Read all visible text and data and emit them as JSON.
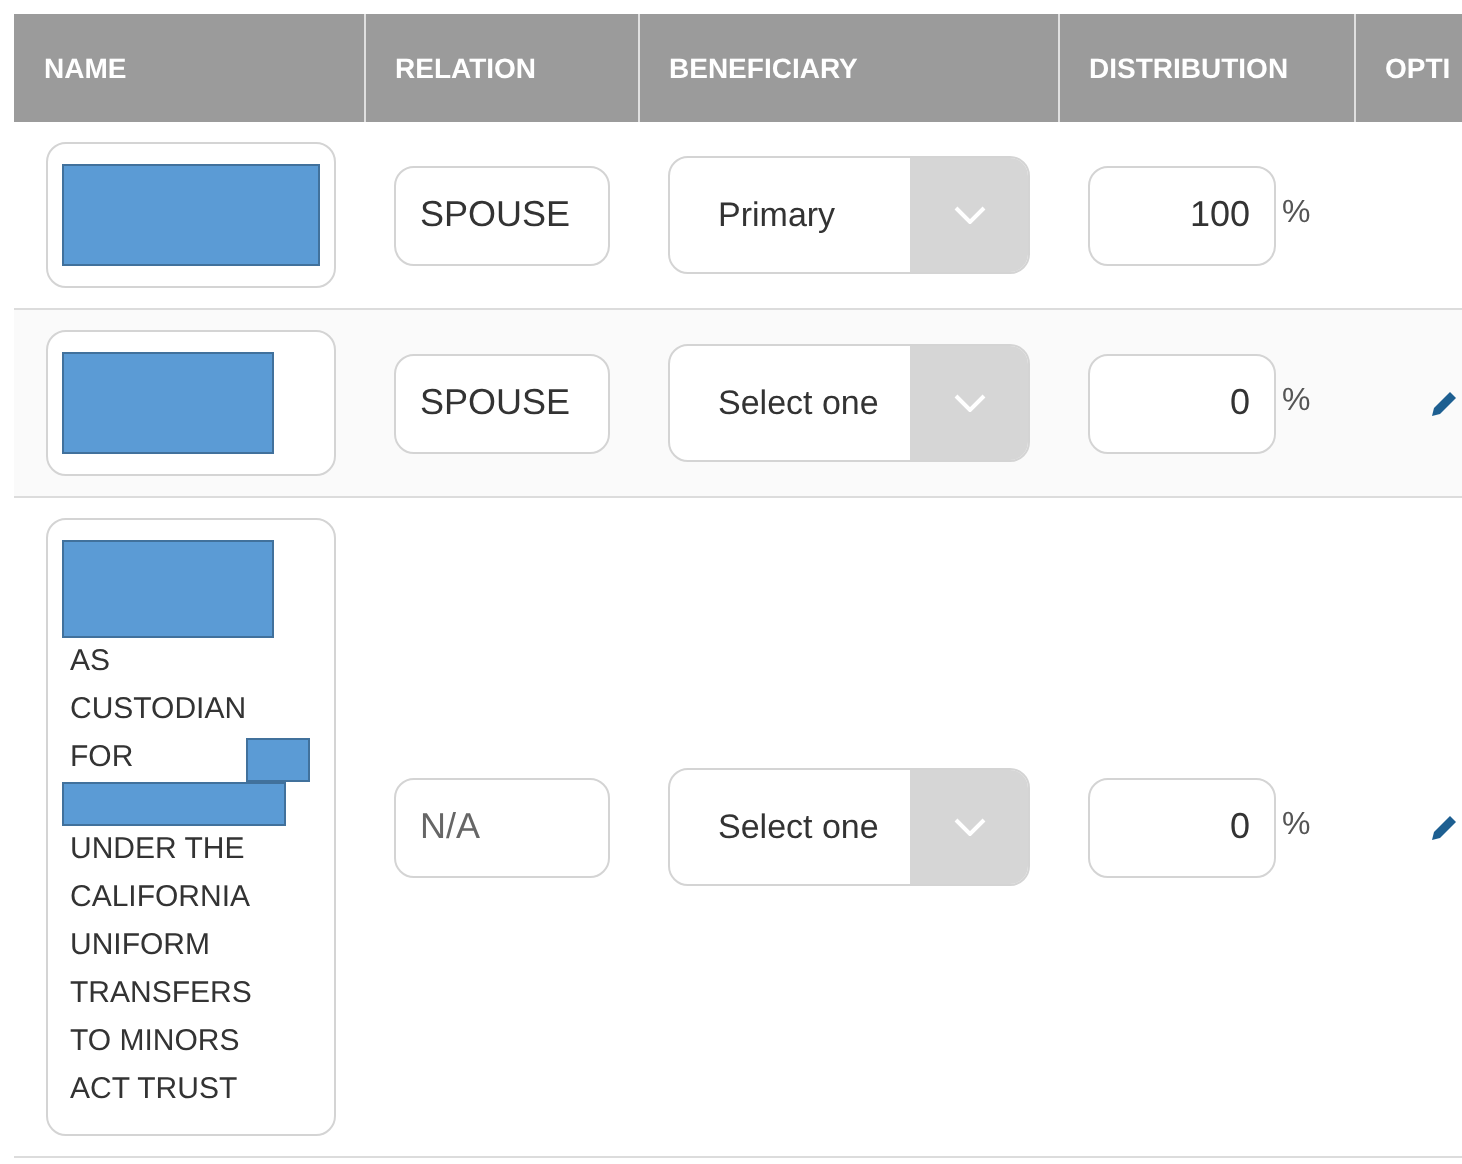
{
  "table": {
    "columns": [
      "NAME",
      "RELATION",
      "BENEFICIARY",
      "DISTRIBUTION",
      "OPTI"
    ],
    "rows": [
      {
        "name": [
          {
            "kind": "redacted"
          }
        ],
        "relation": "SPOUSE",
        "beneficiary": "Primary",
        "distribution": "100",
        "percent": "%",
        "edit": false
      },
      {
        "name": [
          {
            "kind": "redacted"
          }
        ],
        "relation": "SPOUSE",
        "beneficiary": "Select one",
        "distribution": "0",
        "percent": "%",
        "edit": true
      },
      {
        "name": [
          {
            "kind": "redacted"
          },
          {
            "kind": "text",
            "text": "AS CUSTODIAN FOR"
          },
          {
            "kind": "redacted"
          },
          {
            "kind": "text",
            "text": "UNDER THE CALIFORNIA UNIFORM TRANSFERS TO MINORS ACT TRUST"
          }
        ],
        "relation": "N/A",
        "beneficiary": "Select one",
        "distribution": "0",
        "percent": "%",
        "edit": true
      }
    ]
  }
}
